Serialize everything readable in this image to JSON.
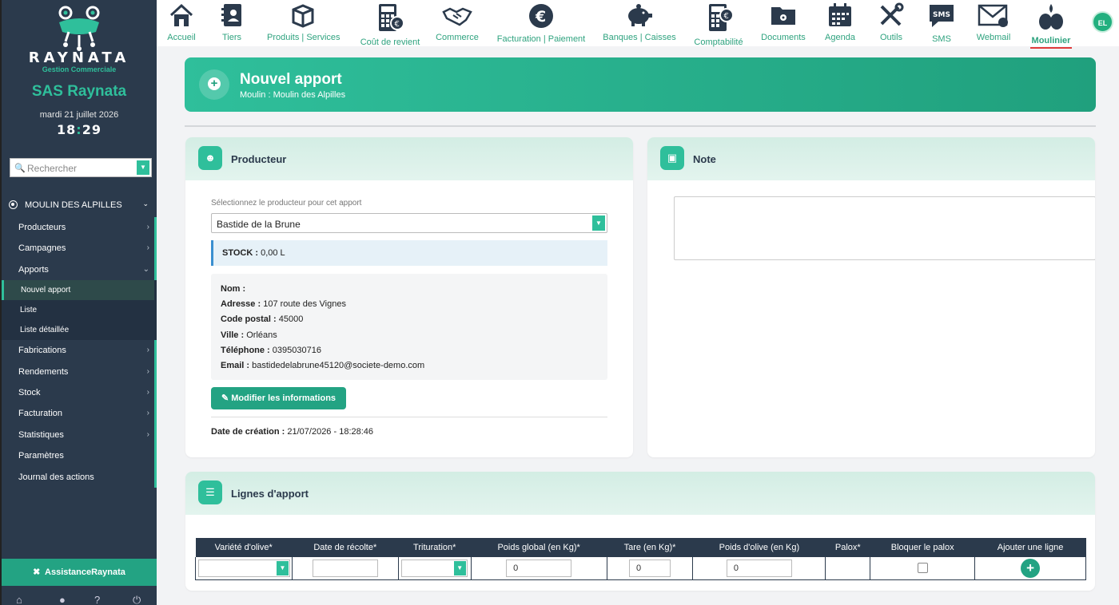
{
  "app": {
    "brand": "RAYNATA",
    "brand_sub": "Gestion Commerciale",
    "company": "SAS Raynata",
    "date": "mardi 21 juillet 2026",
    "time_h": "18",
    "time_m": "29"
  },
  "search": {
    "placeholder": "Rechercher"
  },
  "sidebar": {
    "section": "MOULIN DES ALPILLES",
    "items": [
      {
        "label": "Producteurs"
      },
      {
        "label": "Campagnes"
      },
      {
        "label": "Apports"
      },
      {
        "label": "Nouvel apport"
      },
      {
        "label": "Liste"
      },
      {
        "label": "Liste détaillée"
      },
      {
        "label": "Fabrications"
      },
      {
        "label": "Rendements"
      },
      {
        "label": "Stock"
      },
      {
        "label": "Facturation"
      },
      {
        "label": "Statistiques"
      },
      {
        "label": "Paramètres"
      },
      {
        "label": "Journal des actions"
      }
    ],
    "assist": "AssistanceRaynata"
  },
  "topnav": [
    {
      "label": "Accueil",
      "icon": "home-icon"
    },
    {
      "label": "Tiers",
      "icon": "address-book-icon"
    },
    {
      "label": "Produits | Services",
      "icon": "box-icon"
    },
    {
      "label": "Coût de revient",
      "icon": "calculator-icon"
    },
    {
      "label": "Commerce",
      "icon": "handshake-icon"
    },
    {
      "label": "Facturation | Paiement",
      "icon": "euro-icon"
    },
    {
      "label": "Banques | Caisses",
      "icon": "piggy-bank-icon"
    },
    {
      "label": "Comptabilité",
      "icon": "accounting-icon"
    },
    {
      "label": "Documents",
      "icon": "folder-icon"
    },
    {
      "label": "Agenda",
      "icon": "calendar-icon"
    },
    {
      "label": "Outils",
      "icon": "tools-icon"
    },
    {
      "label": "SMS",
      "icon": "sms-icon"
    },
    {
      "label": "Webmail",
      "icon": "mail-icon"
    },
    {
      "label": "Moulinier",
      "icon": "olive-icon"
    }
  ],
  "user": {
    "initials": "EL"
  },
  "banner": {
    "title": "Nouvel apport",
    "subtitle": "Moulin : Moulin des Alpilles"
  },
  "producer": {
    "title": "Producteur",
    "select_label": "Sélectionnez le producteur pour cet apport",
    "selected": "Bastide de la Brune",
    "stock_label": "STOCK :",
    "stock_value": "0,00 L",
    "nom_label": "Nom :",
    "nom": "",
    "adresse_label": "Adresse :",
    "adresse": "107 route des Vignes",
    "cp_label": "Code postal :",
    "cp": "45000",
    "ville_label": "Ville :",
    "ville": "Orléans",
    "tel_label": "Téléphone :",
    "tel": "0395030716",
    "email_label": "Email :",
    "email": "bastidedelabrune45120@societe-demo.com",
    "edit_button": "Modifier les informations",
    "created_label": "Date de création :",
    "created": "21/07/2026 - 18:28:46"
  },
  "note": {
    "title": "Note",
    "value": ""
  },
  "lines": {
    "title": "Lignes d'apport",
    "headers": [
      "Variété d'olive*",
      "Date de récolte*",
      "Trituration*",
      "Poids global (en Kg)*",
      "Tare (en Kg)*",
      "Poids d'olive (en Kg)",
      "Palox*",
      "Bloquer le palox",
      "Ajouter une ligne"
    ],
    "row": {
      "poids_global": "0",
      "tare": "0",
      "poids_olive": "0"
    }
  }
}
